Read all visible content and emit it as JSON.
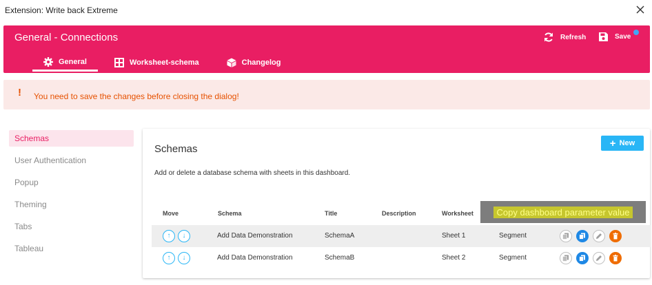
{
  "window": {
    "title": "Extension: Write back Extreme"
  },
  "header": {
    "title": "General - Connections",
    "refresh_label": "Refresh",
    "save_label": "Save",
    "tabs": [
      {
        "label": "General",
        "icon": "gear-icon"
      },
      {
        "label": "Worksheet-schema",
        "icon": "grid-icon"
      },
      {
        "label": "Changelog",
        "icon": "cube-icon"
      }
    ]
  },
  "warning": {
    "mark": "!",
    "message": "You need to save the changes before closing the dialog!"
  },
  "sidebar": {
    "items": [
      {
        "label": "Schemas",
        "active": true
      },
      {
        "label": "User Authentication"
      },
      {
        "label": "Popup"
      },
      {
        "label": "Theming"
      },
      {
        "label": "Tabs"
      },
      {
        "label": "Tableau"
      }
    ]
  },
  "schemas": {
    "title": "Schemas",
    "description": "Add or delete a database schema with sheets in this dashboard.",
    "new_label": "New",
    "tooltip": "Copy dashboard parameter value",
    "columns": {
      "move": "Move",
      "schema": "Schema",
      "title": "Title",
      "description": "Description",
      "worksheet": "Worksheet"
    },
    "rows": [
      {
        "schema": "Add Data Demonstration",
        "title": "SchemaA",
        "description": "",
        "worksheet": "Sheet 1",
        "extra": "Segment"
      },
      {
        "schema": "Add Data Demonstration",
        "title": "SchemaB",
        "description": "",
        "worksheet": "Sheet 2",
        "extra": "Segment"
      }
    ]
  },
  "colors": {
    "accent": "#e91e63",
    "primary_button": "#29b6f6",
    "warning_bg": "#fbe9e7",
    "warning_text": "#e65100"
  }
}
